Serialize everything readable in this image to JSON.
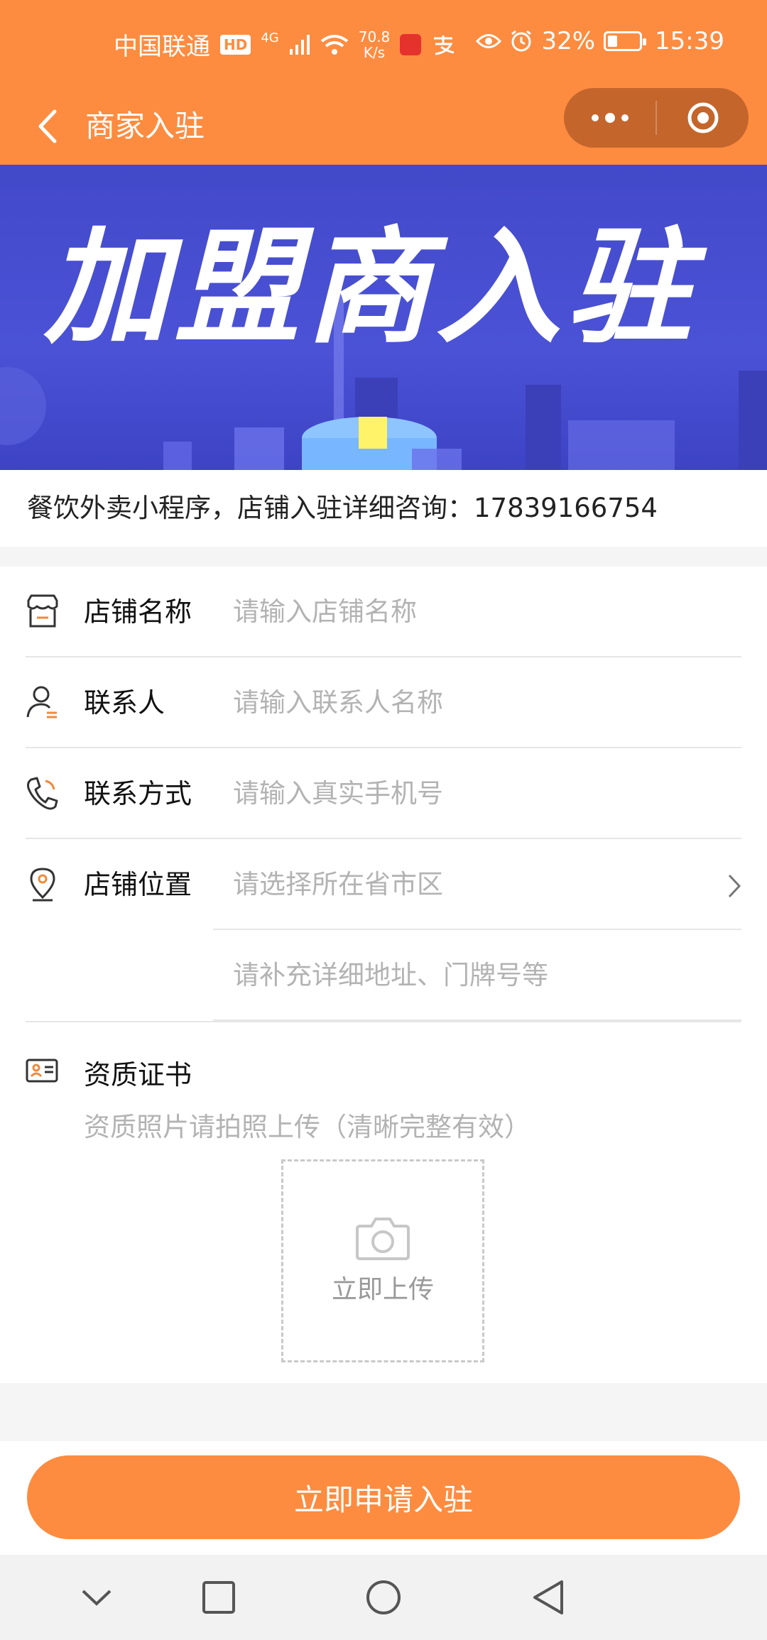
{
  "status_bar": {
    "carrier": "中国联通",
    "hd": "HD",
    "network": "4G",
    "speed_value": "70.8",
    "speed_unit": "K/s",
    "battery": "32%",
    "battery_level": 0.32,
    "time": "15:39"
  },
  "nav": {
    "title": "商家入驻"
  },
  "banner": {
    "title": "加盟商入驻"
  },
  "info": {
    "text": "餐饮外卖小程序，店铺入驻详细咨询：17839166754"
  },
  "form": {
    "store_name": {
      "label": "店铺名称",
      "placeholder": "请输入店铺名称"
    },
    "contact": {
      "label": "联系人",
      "placeholder": "请输入联系人名称"
    },
    "phone": {
      "label": "联系方式",
      "placeholder": "请输入真实手机号"
    },
    "location": {
      "label": "店铺位置",
      "placeholder": "请选择所在省市区"
    },
    "address": {
      "placeholder": "请补充详细地址、门牌号等"
    },
    "certificate": {
      "label": "资质证书",
      "hint": "资质照片请拍照上传（清晰完整有效）",
      "upload_label": "立即上传"
    }
  },
  "submit": {
    "label": "立即申请入驻"
  },
  "colors": {
    "accent": "#fd8c40",
    "banner": "#4249c9",
    "placeholder": "#b3b3b3"
  }
}
